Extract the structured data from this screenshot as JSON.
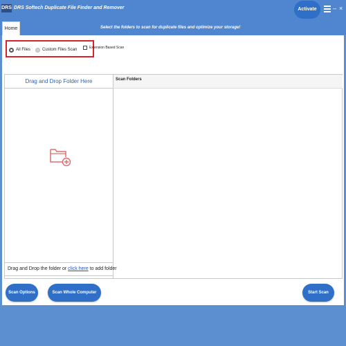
{
  "app": {
    "logo_text": "DRS",
    "title": "DRS Softech Duplicate File Finder and Remover",
    "activate_label": "Activate",
    "menu_icon": "hamburger-menu-icon",
    "minimize_glyph": "–",
    "close_glyph": "×"
  },
  "tabs": {
    "home_label": "Home"
  },
  "instruction": "Select the folders to scan for duplicate files and optimize your storage!",
  "scan_mode": {
    "options": [
      {
        "label": "All Files",
        "selected": true
      },
      {
        "label": "Custom Files Scan",
        "selected": false
      }
    ],
    "extension_label": "Extension Based Scan",
    "extension_checked": false
  },
  "drop_panel": {
    "header": "Drag and Drop Folder Here",
    "footer_prefix": "Drag and Drop the folder or ",
    "footer_link": "click here",
    "footer_suffix": " to add folder",
    "icon": "folder-add-icon"
  },
  "scan_panel": {
    "header": "Scan Folders"
  },
  "buttons": {
    "scan_options": "Scan Options",
    "scan_whole": "Scan Whole Computer",
    "start_scan": "Start Scan"
  },
  "colors": {
    "title_bar": "#4f86cf",
    "button_blue": "#2f6fc7",
    "highlight_red": "#d7232e",
    "folder_icon": "#e06d6d",
    "link_blue": "#2a54b8"
  }
}
